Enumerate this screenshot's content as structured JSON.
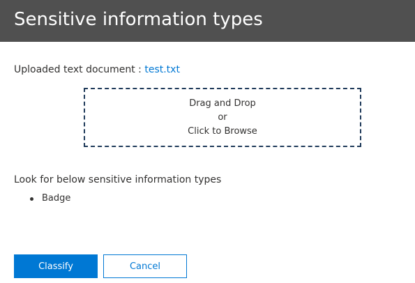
{
  "header": {
    "title": "Sensitive information types"
  },
  "upload": {
    "label": "Uploaded text document : ",
    "file_name": "test.txt"
  },
  "dropzone": {
    "line1": "Drag and Drop",
    "line2": "or",
    "line3": "Click to Browse"
  },
  "types_section": {
    "heading": "Look for below sensitive information types",
    "items": [
      "Badge"
    ]
  },
  "actions": {
    "classify_label": "Classify",
    "cancel_label": "Cancel"
  },
  "colors": {
    "header_bg": "#505050",
    "accent": "#0078d4",
    "dropzone_border": "#1f3a5a"
  }
}
